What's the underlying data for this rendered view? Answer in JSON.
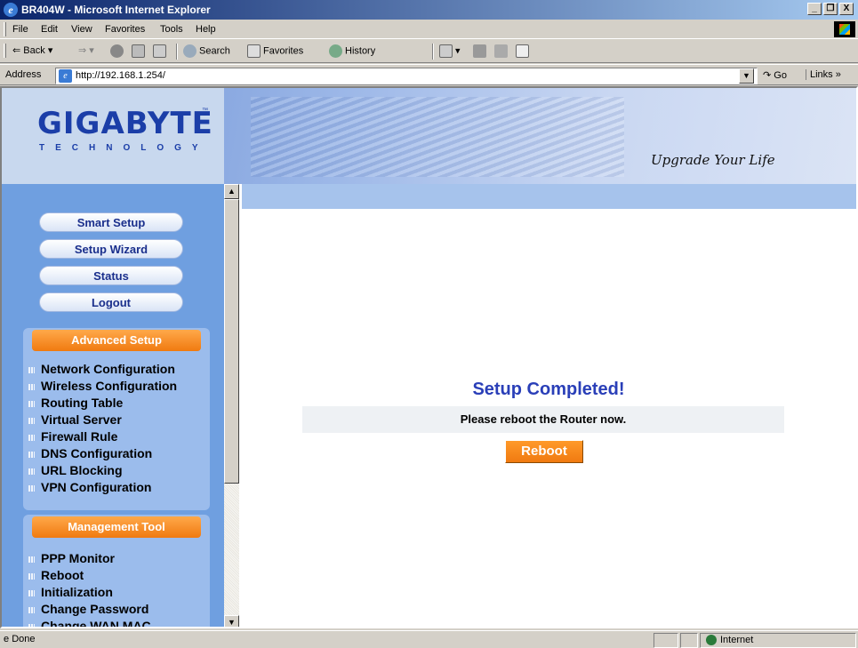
{
  "window": {
    "title": "BR404W - Microsoft Internet Explorer",
    "controls": [
      "_",
      "❐",
      "X"
    ]
  },
  "menu": [
    "File",
    "Edit",
    "View",
    "Favorites",
    "Tools",
    "Help"
  ],
  "toolbar": {
    "back": "Back",
    "search": "Search",
    "favorites": "Favorites",
    "history": "History"
  },
  "address": {
    "label": "Address",
    "url": "http://192.168.1.254/",
    "go": "Go",
    "links": "Links"
  },
  "banner": {
    "logo": "GIGABYTE",
    "logo_sub": "TECHNOLOGY",
    "slogan": "Upgrade Your Life"
  },
  "nav": {
    "buttons": [
      "Smart Setup",
      "Setup Wizard",
      "Status",
      "Logout"
    ],
    "advanced": {
      "header": "Advanced Setup",
      "items": [
        "Network Configuration",
        "Wireless Configuration",
        "Routing Table",
        "Virtual Server",
        "Firewall Rule",
        "DNS Configuration",
        "URL Blocking",
        "VPN Configuration"
      ]
    },
    "management": {
      "header": "Management Tool",
      "items": [
        "PPP Monitor",
        "Reboot",
        "Initialization",
        "Change Password",
        "Change WAN MAC"
      ]
    }
  },
  "main": {
    "title": "Setup Completed!",
    "message": "Please reboot the Router now.",
    "button": "Reboot"
  },
  "status": {
    "text": "Done",
    "zone": "Internet"
  }
}
